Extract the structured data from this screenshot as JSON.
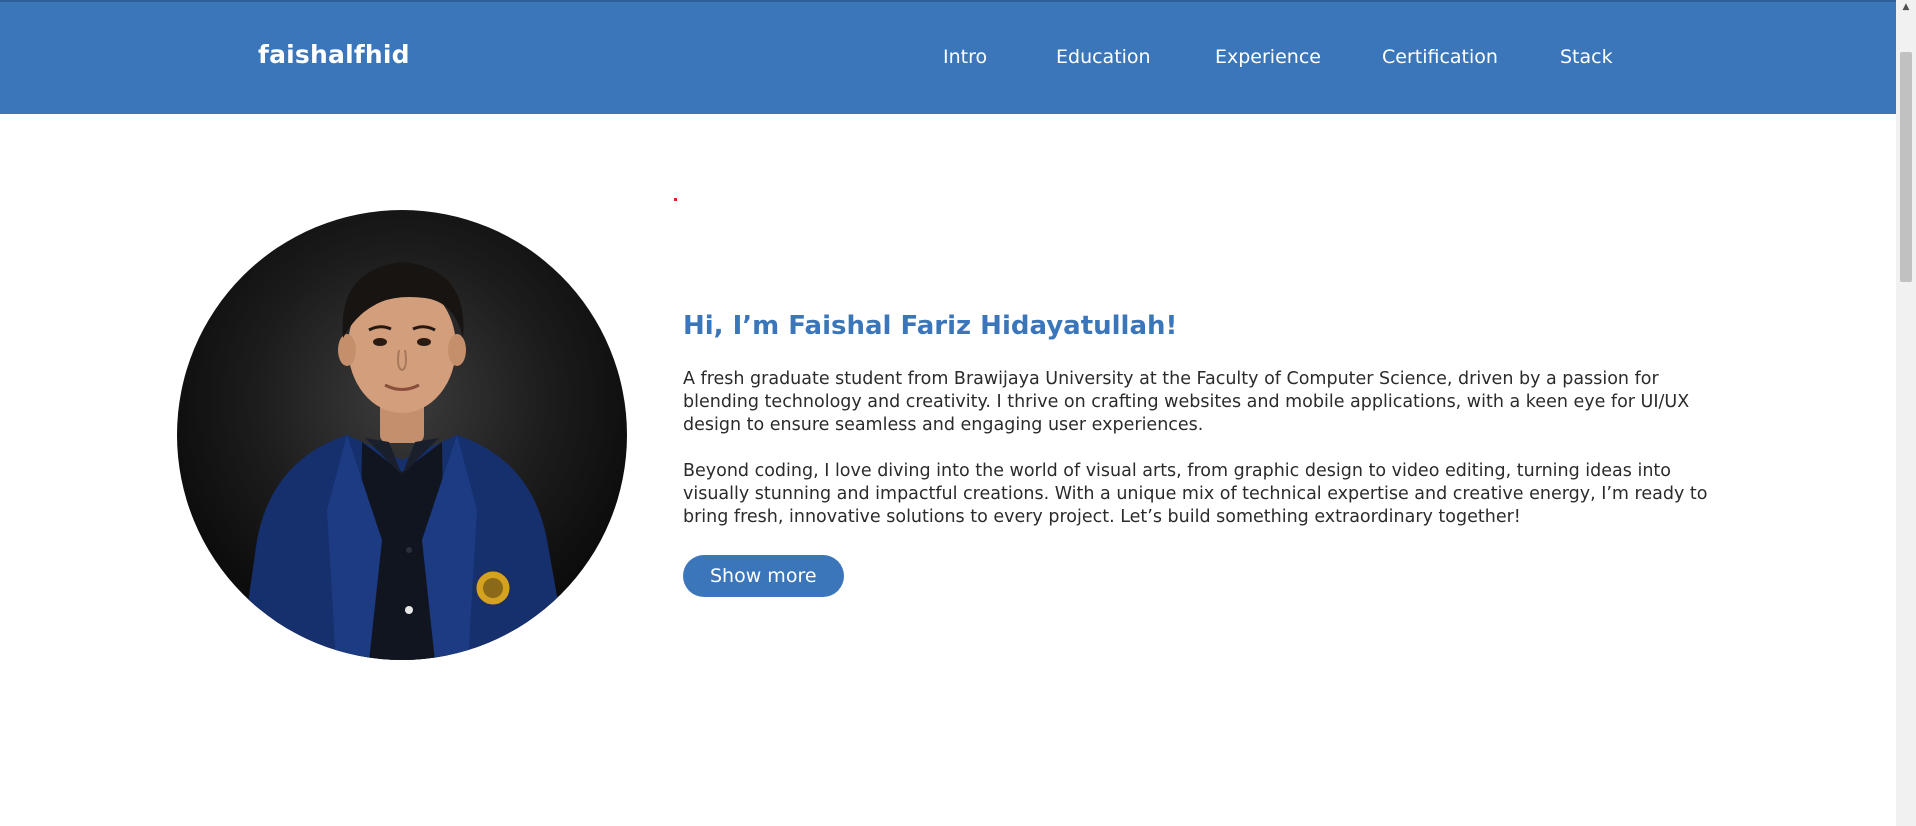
{
  "header": {
    "brand": "faishalfhid",
    "nav": [
      {
        "label": "Intro"
      },
      {
        "label": "Education"
      },
      {
        "label": "Experience"
      },
      {
        "label": "Certification"
      },
      {
        "label": "Stack"
      }
    ]
  },
  "intro": {
    "headline": "Hi, I’m Faishal Fariz Hidayatullah!",
    "paragraphs": [
      "A fresh graduate student from Brawijaya University at the Faculty of Computer Science, driven by a passion for blending technology and creativity. I thrive on crafting websites and mobile applications, with a keen eye for UI/UX design to ensure seamless and engaging user experiences.",
      "Beyond coding, I love diving into the world of visual arts, from graphic design to video editing, turning ideas into visually stunning and impactful creations. With a unique mix of technical expertise and creative energy, I’m ready to bring fresh, innovative solutions to every project. Let’s build something extraordinary together!"
    ],
    "button_label": "Show more"
  },
  "colors": {
    "brand_blue": "#3a76b9",
    "headline": "#3a76b9",
    "body_text": "#2b2b2b",
    "background": "#ffffff"
  },
  "icons": {
    "scroll_up": "scroll-up-arrow-icon"
  }
}
